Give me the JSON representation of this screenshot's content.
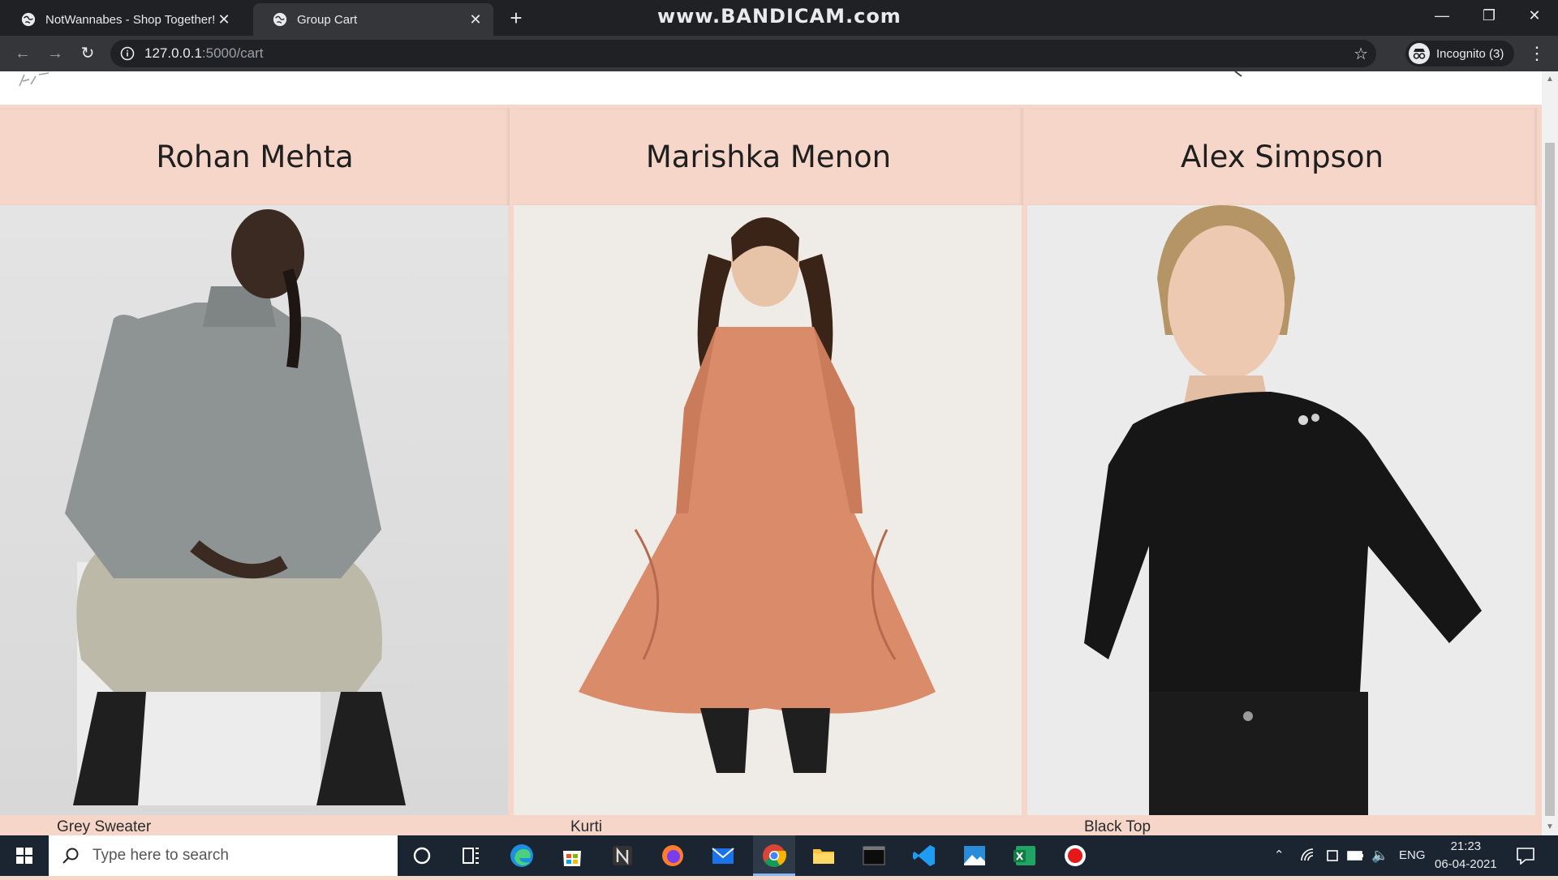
{
  "browser": {
    "tabs": [
      {
        "title": "NotWannabes - Shop Together!",
        "active": false
      },
      {
        "title": "Group Cart",
        "active": true
      }
    ],
    "url_host": "127.0.0.1",
    "url_rest": ":5000/cart",
    "profile_label": "Incognito (3)"
  },
  "watermark": "www.BANDICAM.com",
  "cart": {
    "members": [
      {
        "name": "Rohan Mehta",
        "item": "Grey Sweater"
      },
      {
        "name": "Marishka Menon",
        "item": "Kurti"
      },
      {
        "name": "Alex Simpson",
        "item": "Black Top"
      }
    ]
  },
  "taskbar": {
    "search_placeholder": "Type here to search",
    "language": "ENG",
    "time": "21:23",
    "date": "06-04-2021"
  },
  "colors": {
    "page_bg": "#f6d6c9",
    "chrome_dark": "#202124",
    "chrome_toolbar": "#35363a",
    "taskbar": "#1b2532"
  }
}
